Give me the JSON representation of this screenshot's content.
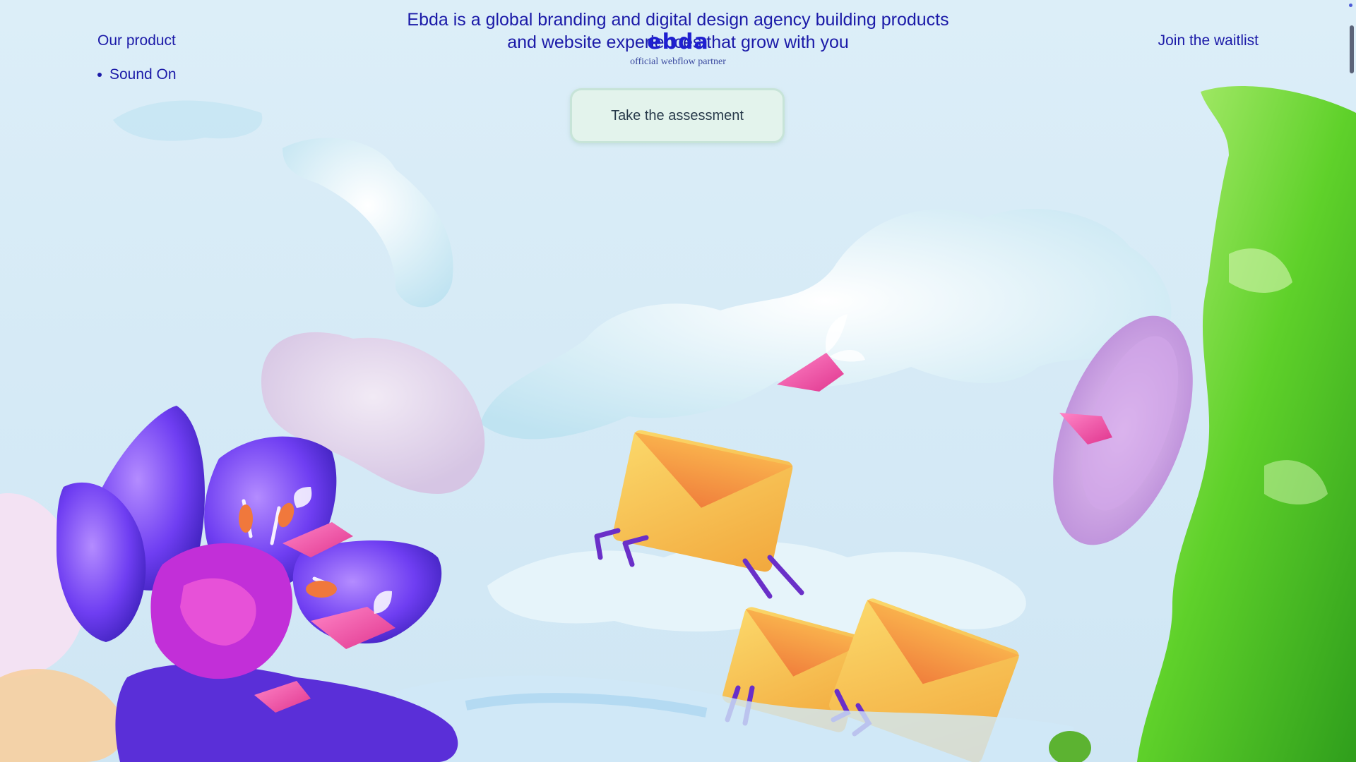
{
  "nav": {
    "product_label": "Our product",
    "sub_items": [
      "Sound On"
    ],
    "waitlist_label": "Join the waitlist"
  },
  "hero": {
    "tagline": "Ebda is a global branding and digital design agency building products and website experiences that grow with you",
    "logo_text": "ebda",
    "partner_text": "official webflow partner",
    "cta_label": "Take the assessment"
  },
  "colors": {
    "accent": "#1b1aa8",
    "background": "#d9edf8",
    "cta_background": "#e3f3ec",
    "envelope": "#f6c046",
    "flower": "#7a3cf0",
    "green_blob": "#5fd12a",
    "arrow_pink": "#f050a8"
  }
}
